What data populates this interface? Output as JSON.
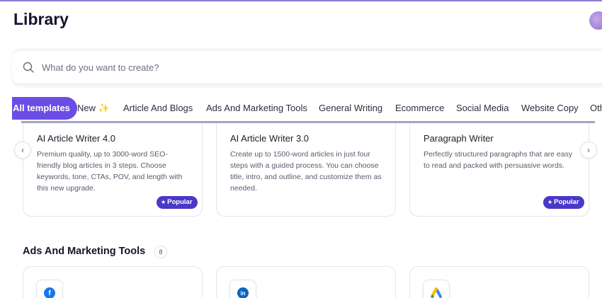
{
  "header": {
    "title": "Library"
  },
  "search": {
    "placeholder": "What do you want to create?"
  },
  "tabs": [
    {
      "label": "All templates",
      "active": true
    },
    {
      "label": "New",
      "active": false
    },
    {
      "label": "Article And Blogs",
      "active": false
    },
    {
      "label": "Ads And Marketing Tools",
      "active": false
    },
    {
      "label": "General Writing",
      "active": false
    },
    {
      "label": "Ecommerce",
      "active": false
    },
    {
      "label": "Social Media",
      "active": false
    },
    {
      "label": "Website Copy",
      "active": false
    },
    {
      "label": "Oth",
      "active": false
    }
  ],
  "cards": [
    {
      "title": "AI Article Writer 4.0",
      "description": "Premium quality, up to 3000-word SEO-friendly blog articles in 3 steps. Choose keywords, tone, CTAs, POV, and length with this new upgrade.",
      "badge": "Popular"
    },
    {
      "title": "AI Article Writer 3.0",
      "description": "Create up to 1500-word articles in just four steps with a guided process. You can choose title, intro, and outline, and customize them as needed.",
      "badge": ""
    },
    {
      "title": "Paragraph Writer",
      "description": "Perfectly structured paragraphs that are easy to read and packed with persuasive words.",
      "badge": "Popular"
    }
  ],
  "section": {
    "title": "Ads And Marketing Tools",
    "count": "8"
  },
  "colors": {
    "accent": "#6b4de6",
    "badge": "#4a38c7",
    "facebook": "#1877f2",
    "linkedin": "#0a66c2"
  },
  "icons": {
    "search": "search-icon",
    "new_tab": "sparkle-icon",
    "prev": "chevron-left-icon",
    "next": "chevron-right-icon",
    "brands": [
      "facebook-icon",
      "linkedin-icon",
      "google-ads-icon"
    ]
  }
}
